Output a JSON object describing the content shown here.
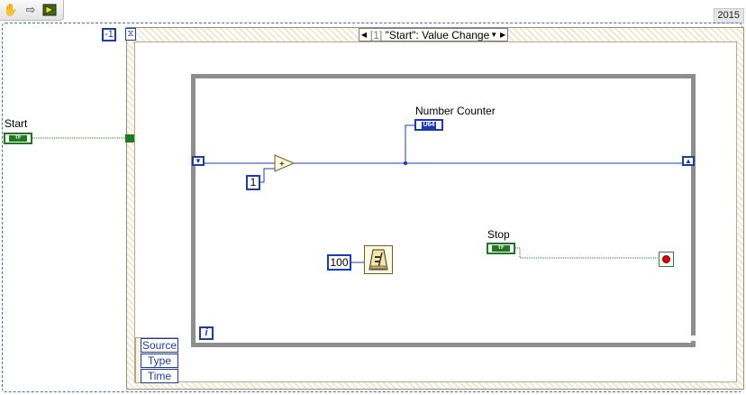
{
  "toolbar": {
    "icons": [
      "hand-icon",
      "arrow-right-icon",
      "run-arrow-icon"
    ]
  },
  "version": "2015",
  "event_structure": {
    "timeout_value": "-1",
    "selector_index": "[1]",
    "selector_label": "\"Start\": Value Change",
    "event_data_items": [
      "Source",
      "Type",
      "Time"
    ]
  },
  "controls": {
    "start_label": "Start",
    "stop_label": "Stop",
    "bool_text": "TF"
  },
  "indicators": {
    "number_counter_label": "Number Counter",
    "number_counter_type": "U64"
  },
  "constants": {
    "increment": "1",
    "wait_ms": "100"
  },
  "colors": {
    "wire_numeric": "#1a3bb5",
    "wire_boolean": "#1f7a1f",
    "loop_border": "#8e8e8e",
    "stop_light": "#e00000"
  }
}
